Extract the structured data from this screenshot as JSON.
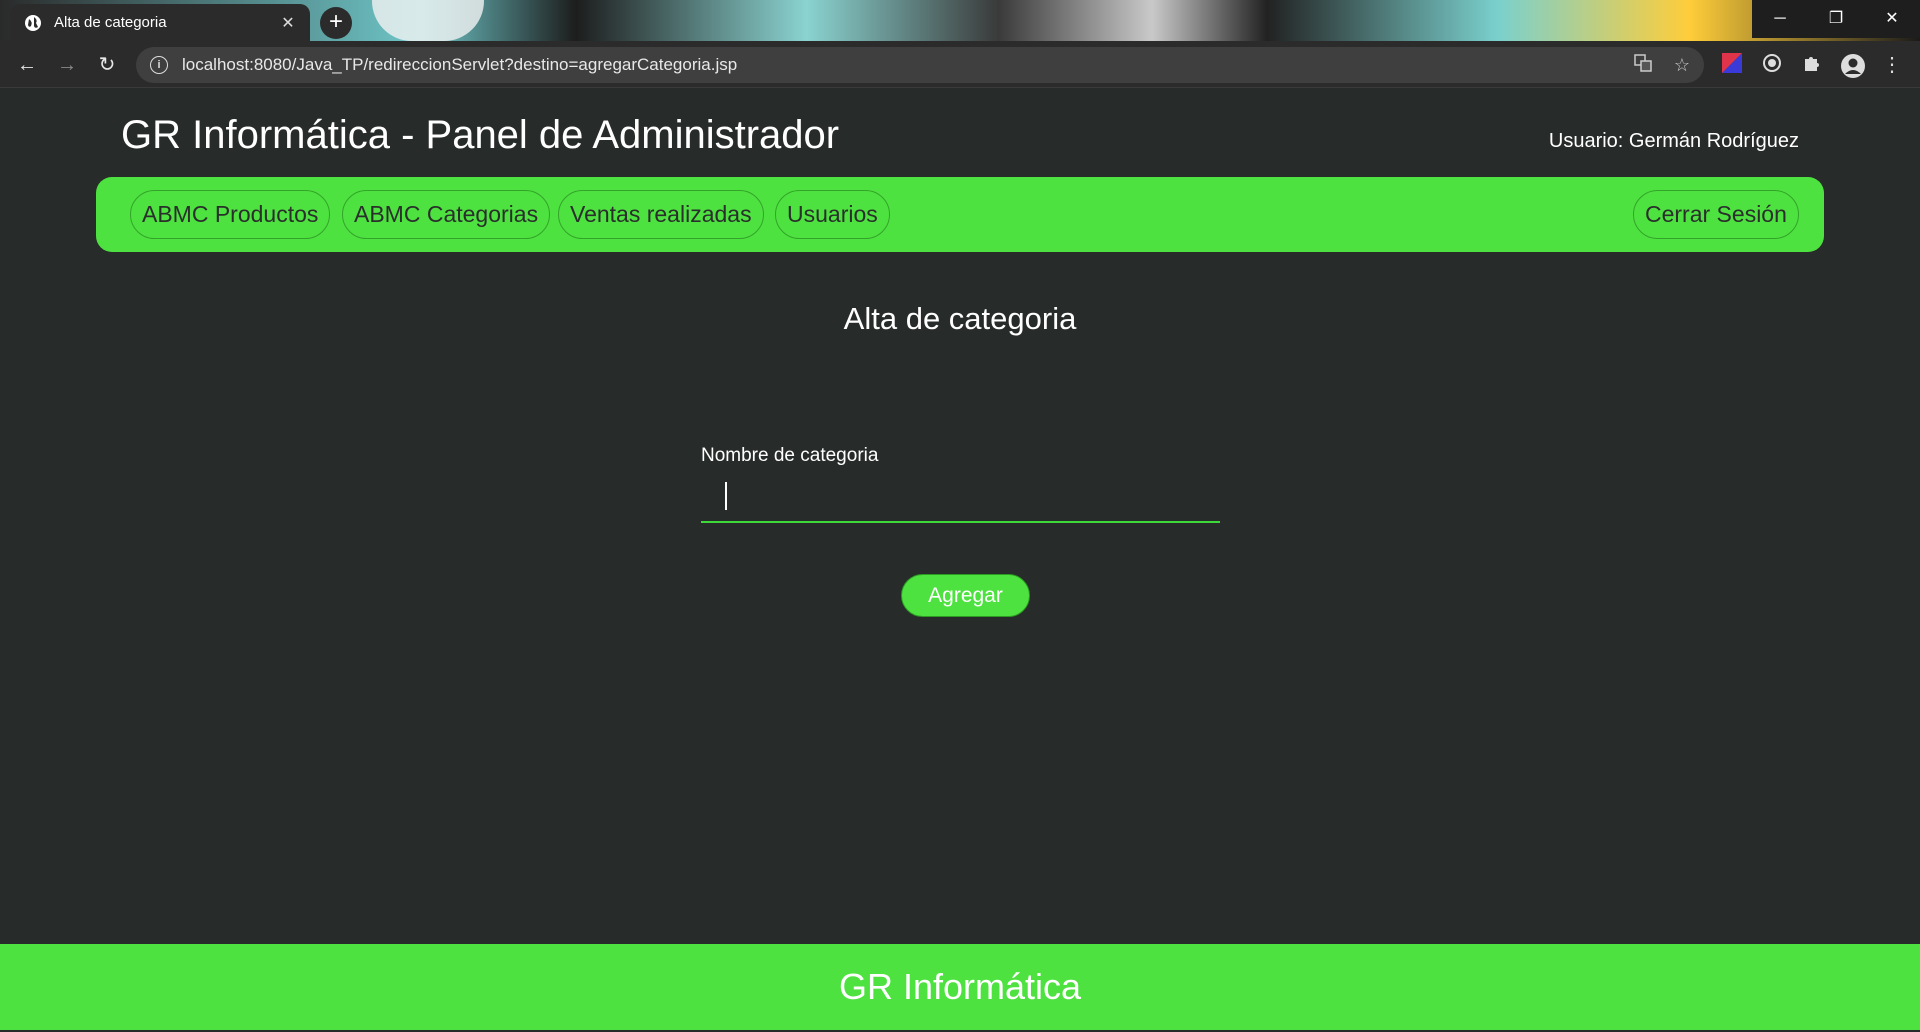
{
  "browser": {
    "tab_title": "Alta de categoria",
    "tab_close": "✕",
    "new_tab": "+",
    "url": "localhost:8080/Java_TP/redireccionServlet?destino=agregarCategoria.jsp",
    "window_controls": {
      "minimize": "─",
      "restore": "❐",
      "close": "✕"
    },
    "nav": {
      "back": "←",
      "forward": "→",
      "reload": "↻"
    }
  },
  "header": {
    "title": "GR Informática - Panel de Administrador",
    "user": "Usuario: Germán Rodríguez"
  },
  "nav": {
    "items": [
      "ABMC Productos",
      "ABMC Categorias",
      "Ventas realizadas",
      "Usuarios"
    ],
    "logout": "Cerrar Sesión"
  },
  "form": {
    "heading": "Alta de categoria",
    "label": "Nombre de categoria",
    "value": "",
    "submit": "Agregar"
  },
  "footer": {
    "text": "GR Informática"
  },
  "colors": {
    "accent": "#4de23f",
    "background": "#272b29",
    "nav_text": "#2a2f2c"
  }
}
